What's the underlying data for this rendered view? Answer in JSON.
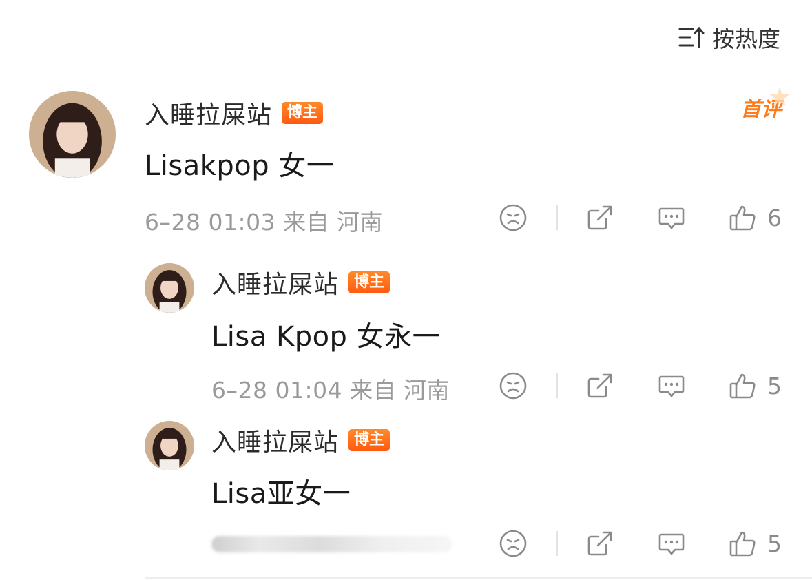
{
  "sort": {
    "label": "按热度",
    "icon": "sort-lines-up-arrow-icon"
  },
  "comments": [
    {
      "username": "入睡拉屎站",
      "badge": "博主",
      "content": "Lisakpop 女一",
      "meta": "6–28 01:03  来自 河南",
      "likes": "6",
      "first_label": "首评"
    },
    {
      "username": "入睡拉屎站",
      "badge": "博主",
      "content": "Lisa Kpop 女永一",
      "meta": "6–28 01:04  来自 河南",
      "likes": "5"
    },
    {
      "username": "入睡拉屎站",
      "badge": "博主",
      "content": "Lisa亚女一",
      "meta": "",
      "likes": "5"
    }
  ],
  "icons": [
    "sad-face-icon",
    "share-icon",
    "comment-icon",
    "thumbs-up-icon"
  ],
  "colors": {
    "accent_orange": "#ff6a14",
    "meta_gray": "#9a9a9a"
  }
}
